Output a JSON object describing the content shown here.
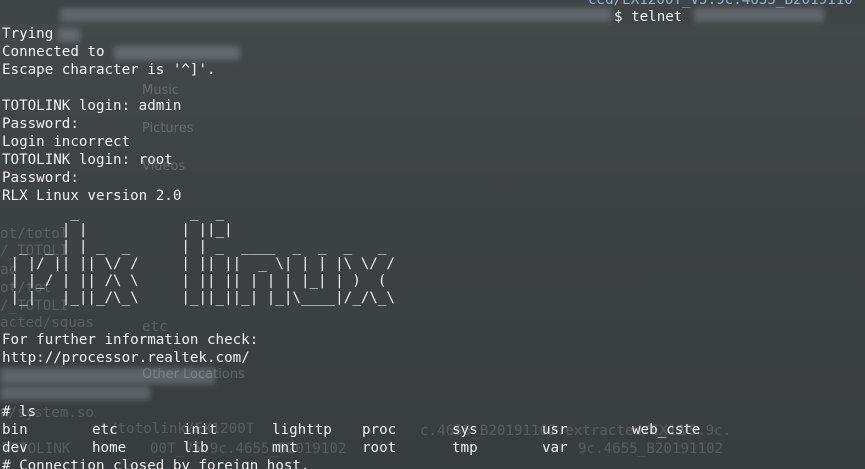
{
  "terminal": {
    "cwd_fragment": "ced/EX1200T_V5.9c.4655_B2019110",
    "command": "$ telnet",
    "lines": [
      "Trying",
      "Connected to",
      "Escape character is '^]'.",
      "",
      "TOTOLINK login: admin",
      "Password:",
      "Login incorrect",
      "TOTOLINK login: root",
      "Password:",
      "RLX Linux version 2.0"
    ],
    "ascii_art": "        _             _  _\n       | |           | ||_|\n  _  _ | | _  _      | | _  ____  _  _  _   _\n | |/ || || \\/ /     | || ||  _ \\| | | |\\ \\/ /\n | |_/ | || /\\ \\     | || || | | | |_| | )  (\n |_|   |_||_/\\_\\     |_||_||_| |_|\\____|/_/\\_\\",
    "footer_lines": [
      "For further information check:",
      "http://processor.realtek.com/"
    ],
    "prompt_line": "# ls",
    "ls_rows": [
      [
        "bin",
        "etc",
        "init",
        "lighttp",
        "proc",
        "sys",
        "usr",
        "web_cste"
      ],
      [
        "dev",
        "home",
        "lib",
        "mnt",
        "root",
        "tmp",
        "var"
      ]
    ],
    "closing_line": "# Connection closed by foreign host."
  },
  "background_ghost": {
    "sidebar_items": [
      "Music",
      "Pictures",
      "Videos",
      "Other Locations"
    ],
    "left_fragments": [
      "ot/totol",
      "/_TOTOLI",
      "ac",
      "ot/tot",
      "/_TOTOLI",
      "acted/squas",
      "n/system.so"
    ],
    "bottom_fragments": [
      "etc",
      "ot/totolink/EX1200T",
      "c.4655_B20191102.extracted/EX12",
      "V5.9c.",
      "TOTOLINK",
      "00T_V5.9c.4655_B2019102",
      "9c.4655_B20191102"
    ]
  }
}
